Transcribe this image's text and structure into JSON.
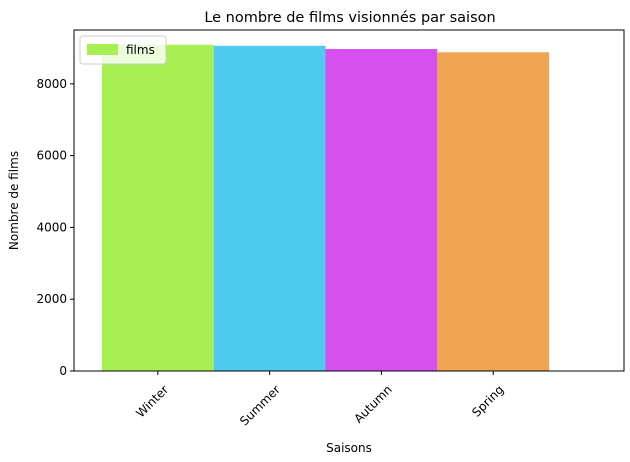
{
  "chart_data": {
    "type": "bar",
    "title": "Le nombre de films visionnés par saison",
    "xlabel": "Saisons",
    "ylabel": "Nombre de films",
    "categories": [
      "Winter",
      "Summer",
      "Autumn",
      "Spring"
    ],
    "series": [
      {
        "name": "films",
        "values": [
          9090,
          9060,
          8970,
          8880
        ],
        "colors": [
          "#a7ef52",
          "#4ec9f0",
          "#d64fef",
          "#f0a351"
        ]
      }
    ],
    "ylim": [
      0,
      9500
    ],
    "yticks": [
      0,
      2000,
      4000,
      6000,
      8000
    ],
    "xtick_rotation": 45,
    "grid": false,
    "legend": {
      "position": "top-left",
      "label": "films",
      "color": "#a7ef52"
    }
  }
}
